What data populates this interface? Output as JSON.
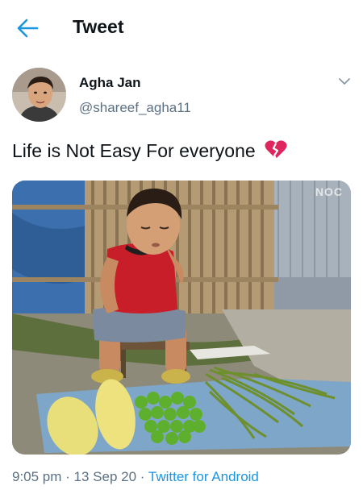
{
  "header": {
    "title": "Tweet"
  },
  "author": {
    "display_name": "Agha Jan",
    "handle": "@shareef_agha11"
  },
  "tweet": {
    "text": "Life is Not Easy For everyone"
  },
  "media": {
    "watermark": "NOC"
  },
  "meta": {
    "time": "9:05 pm",
    "separator": " · ",
    "date": "13 Sep 20",
    "source": "Twitter for Android"
  },
  "colors": {
    "accent": "#1b95e0",
    "muted": "#5b7083",
    "heart": "#e0245e"
  },
  "icons": {
    "back": "arrow-left-icon",
    "more": "chevron-down-icon",
    "emoji": "broken-heart-icon"
  }
}
